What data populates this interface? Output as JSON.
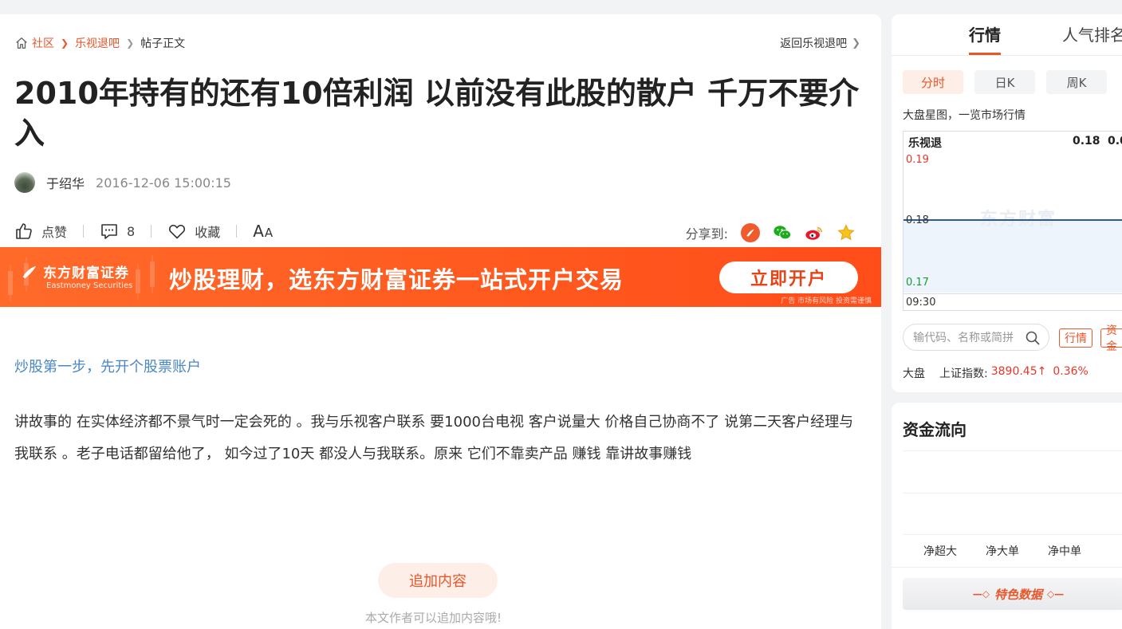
{
  "breadcrumb": {
    "items": [
      "社区",
      "乐视退吧"
    ],
    "current": "帖子正文",
    "back_label": "返回乐视退吧"
  },
  "post": {
    "title": "2010年持有的还有10倍利润 以前没有此股的散户 千万不要介入",
    "author": "于绍华",
    "time": "2016-12-06 15:00:15",
    "like_label": "点赞",
    "comment_count": "8",
    "favorite_label": "收藏",
    "font_label_big": "A",
    "font_label_small": "A",
    "share_label": "分享到:",
    "promo_link": "炒股第一步，先开个股票账户",
    "body": "讲故事的 在实体经济都不景气时一定会死的 。我与乐视客户联系 要1000台电视 客户说量大 价格自己协商不了 说第二天客户经理与我联系 。老子电话都留给他了， 如今过了10天 都没人与我联系。原来 它们不靠卖产品 赚钱 靠讲故事赚钱",
    "append_button": "追加内容",
    "append_tip": "本文作者可以追加内容哦!"
  },
  "banner": {
    "logo_cn": "东方财富证券",
    "logo_en": "Eastmoney Securities",
    "slogan": "炒股理财，选东方财富证券一站式开户交易",
    "cta": "立即开户",
    "disclaimer": "广告 市场有风险 投资需谨慎"
  },
  "sidebar": {
    "tabs": [
      "行情",
      "人气排名"
    ],
    "ktabs": [
      "分时",
      "日K",
      "周K"
    ],
    "market_tip": "大盘星图，一览市场行情",
    "chart": {
      "stock_name": "乐视退",
      "price": "0.18",
      "change_partial": "0.0",
      "high_label": "0.19",
      "mid_label": "0.18",
      "low_label": "0.17",
      "start_time": "09:30",
      "watermark": "东方财富"
    },
    "search_placeholder": "输代码、名称或简拼",
    "pills": [
      "行情",
      "资金"
    ],
    "index": {
      "label": "大盘",
      "name": "上证指数:",
      "value": "3890.45",
      "arrow": "↑",
      "change": "0.36%"
    }
  },
  "flow": {
    "title": "资金流向",
    "labels": [
      "净超大",
      "净大单",
      "净中单"
    ],
    "feature_label": "特色数据"
  },
  "colors": {
    "accent": "#e8562a",
    "link": "#4a86c5",
    "up": "#e8362a",
    "down": "#1a9a3a"
  }
}
